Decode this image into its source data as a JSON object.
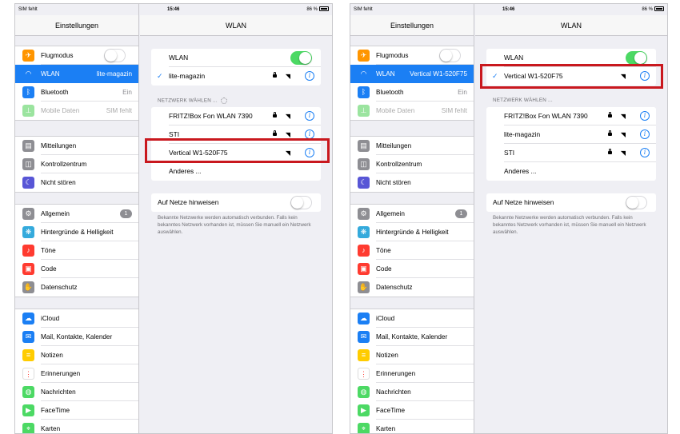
{
  "accent": "#1b7ff4",
  "toggle_on_color": "#4cd964",
  "highlight_color": "#c9181e",
  "panels": [
    {
      "status": {
        "carrier": "SIM fehlt",
        "time": "15:46",
        "battery": "86 %"
      },
      "master": {
        "title": "Einstellungen",
        "groups": [
          [
            {
              "icon": "airplane-icon",
              "color": "#ff9500",
              "label": "Flugmodus",
              "control": "toggle",
              "on": false
            },
            {
              "icon": "wifi-icon",
              "color": "#1b7ff4",
              "label": "WLAN",
              "value": "lite-magazin",
              "selected": true
            },
            {
              "icon": "bluetooth-icon",
              "color": "#1b7ff4",
              "label": "Bluetooth",
              "value": "Ein"
            },
            {
              "icon": "antenna-icon",
              "color": "#9be49f",
              "label": "Mobile Daten",
              "value": "SIM fehlt",
              "disabled": true
            }
          ],
          [
            {
              "icon": "notifications-icon",
              "color": "#8e8e93",
              "label": "Mitteilungen"
            },
            {
              "icon": "control-center-icon",
              "color": "#8e8e93",
              "label": "Kontrollzentrum"
            },
            {
              "icon": "moon-icon",
              "color": "#5856d6",
              "label": "Nicht stören"
            }
          ],
          [
            {
              "icon": "gear-icon",
              "color": "#8e8e93",
              "label": "Allgemein",
              "badge": "1"
            },
            {
              "icon": "wallpaper-icon",
              "color": "#34aadc",
              "label": "Hintergründe & Helligkeit"
            },
            {
              "icon": "sounds-icon",
              "color": "#ff3b30",
              "label": "Töne"
            },
            {
              "icon": "lock-icon",
              "color": "#ff3b30",
              "label": "Code"
            },
            {
              "icon": "hand-icon",
              "color": "#8e8e93",
              "label": "Datenschutz"
            }
          ],
          [
            {
              "icon": "icloud-icon",
              "color": "#1b7ff4",
              "label": "iCloud"
            },
            {
              "icon": "mail-icon",
              "color": "#1b7ff4",
              "label": "Mail, Kontakte, Kalender"
            },
            {
              "icon": "notes-icon",
              "color": "#ffcc00",
              "label": "Notizen"
            },
            {
              "icon": "reminders-icon",
              "color": "#ffffff",
              "label": "Erinnerungen"
            },
            {
              "icon": "messages-icon",
              "color": "#4cd964",
              "label": "Nachrichten"
            },
            {
              "icon": "facetime-icon",
              "color": "#4cd964",
              "label": "FaceTime"
            },
            {
              "icon": "maps-icon",
              "color": "#4cd964",
              "label": "Karten"
            }
          ]
        ]
      },
      "detail": {
        "title": "WLAN",
        "wlan_label": "WLAN",
        "wlan_on": true,
        "connected": {
          "name": "lite-magazin",
          "locked": true
        },
        "section_header": "NETZWERK WÄHLEN ...",
        "show_spinner": true,
        "networks": [
          {
            "name": "FRITZ!Box Fon WLAN 7390",
            "locked": true
          },
          {
            "name": "STI",
            "locked": true
          },
          {
            "name": "Vertical W1-520F75",
            "locked": false
          }
        ],
        "other_label": "Anderes ...",
        "ask_label": "Auf Netze hinweisen",
        "ask_on": false,
        "footnote": "Bekannte Netzwerke werden automatisch verbunden. Falls kein bekanntes Netzwerk vorhanden ist, müssen Sie manuell ein Netzwerk auswählen."
      }
    },
    {
      "status": {
        "carrier": "SIM fehlt",
        "time": "15:46",
        "battery": "86 %"
      },
      "master": {
        "title": "Einstellungen",
        "groups": [
          [
            {
              "icon": "airplane-icon",
              "color": "#ff9500",
              "label": "Flugmodus",
              "control": "toggle",
              "on": false
            },
            {
              "icon": "wifi-icon",
              "color": "#1b7ff4",
              "label": "WLAN",
              "value": "Vertical W1-520F75",
              "selected": true
            },
            {
              "icon": "bluetooth-icon",
              "color": "#1b7ff4",
              "label": "Bluetooth",
              "value": "Ein"
            },
            {
              "icon": "antenna-icon",
              "color": "#9be49f",
              "label": "Mobile Daten",
              "value": "SIM fehlt",
              "disabled": true
            }
          ],
          [
            {
              "icon": "notifications-icon",
              "color": "#8e8e93",
              "label": "Mitteilungen"
            },
            {
              "icon": "control-center-icon",
              "color": "#8e8e93",
              "label": "Kontrollzentrum"
            },
            {
              "icon": "moon-icon",
              "color": "#5856d6",
              "label": "Nicht stören"
            }
          ],
          [
            {
              "icon": "gear-icon",
              "color": "#8e8e93",
              "label": "Allgemein",
              "badge": "1"
            },
            {
              "icon": "wallpaper-icon",
              "color": "#34aadc",
              "label": "Hintergründe & Helligkeit"
            },
            {
              "icon": "sounds-icon",
              "color": "#ff3b30",
              "label": "Töne"
            },
            {
              "icon": "lock-icon",
              "color": "#ff3b30",
              "label": "Code"
            },
            {
              "icon": "hand-icon",
              "color": "#8e8e93",
              "label": "Datenschutz"
            }
          ],
          [
            {
              "icon": "icloud-icon",
              "color": "#1b7ff4",
              "label": "iCloud"
            },
            {
              "icon": "mail-icon",
              "color": "#1b7ff4",
              "label": "Mail, Kontakte, Kalender"
            },
            {
              "icon": "notes-icon",
              "color": "#ffcc00",
              "label": "Notizen"
            },
            {
              "icon": "reminders-icon",
              "color": "#ffffff",
              "label": "Erinnerungen"
            },
            {
              "icon": "messages-icon",
              "color": "#4cd964",
              "label": "Nachrichten"
            },
            {
              "icon": "facetime-icon",
              "color": "#4cd964",
              "label": "FaceTime"
            },
            {
              "icon": "maps-icon",
              "color": "#4cd964",
              "label": "Karten"
            }
          ]
        ]
      },
      "detail": {
        "title": "WLAN",
        "wlan_label": "WLAN",
        "wlan_on": true,
        "connected": {
          "name": "Vertical W1-520F75",
          "locked": false
        },
        "section_header": "NETZWERK WÄHLEN ...",
        "show_spinner": false,
        "networks": [
          {
            "name": "FRITZ!Box Fon WLAN 7390",
            "locked": true
          },
          {
            "name": "lite-magazin",
            "locked": true
          },
          {
            "name": "STI",
            "locked": true
          }
        ],
        "other_label": "Anderes ...",
        "ask_label": "Auf Netze hinweisen",
        "ask_on": false,
        "footnote": "Bekannte Netzwerke werden automatisch verbunden. Falls kein bekanntes Netzwerk vorhanden ist, müssen Sie manuell ein Netzwerk auswählen."
      }
    }
  ]
}
